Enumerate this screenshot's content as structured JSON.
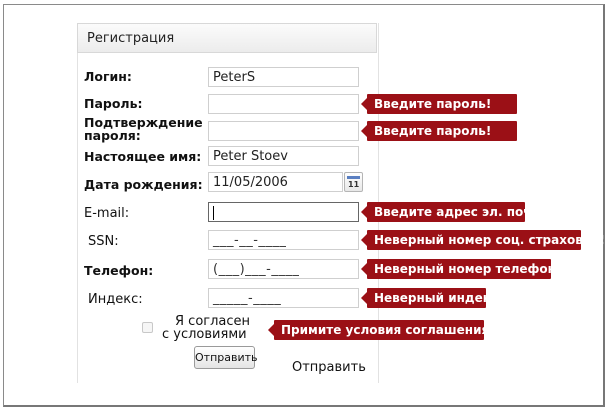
{
  "panel": {
    "title": "Регистрация"
  },
  "fields": {
    "login": {
      "label": "Логин:",
      "value": "PeterS"
    },
    "password": {
      "label": "Пароль:",
      "value": "",
      "error": "Введите пароль!"
    },
    "confirm": {
      "label_line1": "Подтверждение",
      "label_line2": "пароля:",
      "value": "",
      "error": "Введите пароль!"
    },
    "realname": {
      "label": "Настоящее имя:",
      "value": "Peter Stoev"
    },
    "birthdate": {
      "label": "Дата рождения:",
      "value": "11/05/2006",
      "calendar_day": "11"
    },
    "email": {
      "label": "E-mail:",
      "value": "",
      "error": "Введите адрес эл. почты!"
    },
    "ssn": {
      "label": "SSN:",
      "mask": "___-__-____",
      "error": "Неверный номер соц. страховки!"
    },
    "phone": {
      "label": "Телефон:",
      "mask": "(___)___-____",
      "error": "Неверный номер телефона!"
    },
    "zip": {
      "label": "Индекс:",
      "mask": "_____-____",
      "error": "Неверный индекс!"
    }
  },
  "terms": {
    "label_line1": "Я согласен",
    "label_line2": "с условиями",
    "error": "Примите условия соглашения"
  },
  "submit": {
    "button_label": "Отправить",
    "plain_label": "Отправить"
  },
  "colors": {
    "error_bg": "#9b1016",
    "error_text": "#ffffff",
    "calendar_accent": "#5a7fc1"
  }
}
